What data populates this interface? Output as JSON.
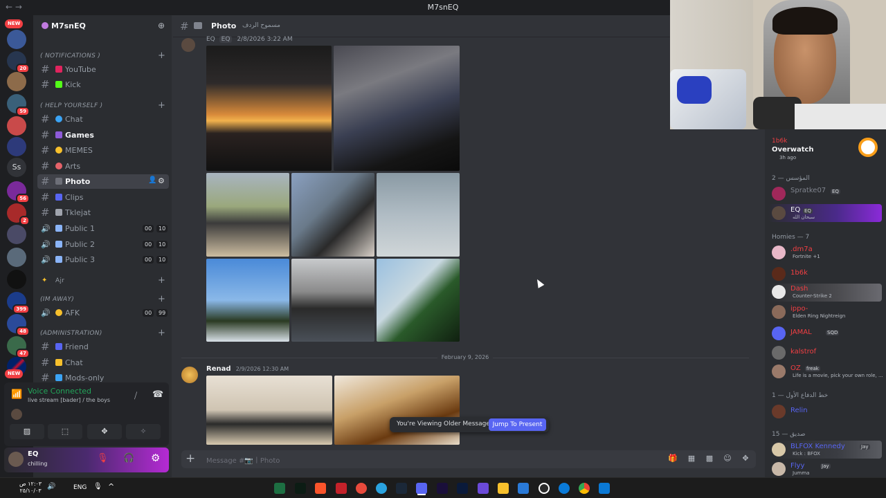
{
  "window": {
    "title": "M7snEQ",
    "nav": "← →"
  },
  "rail": {
    "new_top": "NEW",
    "new_bottom": "NEW",
    "badges": [
      "20",
      "59",
      "56",
      "2",
      "399",
      "48",
      "47"
    ],
    "text_server": "Ss"
  },
  "server": {
    "name": "M7snEQ"
  },
  "categories": {
    "notifications": "( NOTIFICATIONS )",
    "help": "( HELP YOURSELF )",
    "ajr": "Ajr",
    "away": "(IM AWAY)",
    "admin": "(ADMINISTRATION)"
  },
  "channels": {
    "youtube": "YouTube",
    "kick": "Kick",
    "chat": "Chat",
    "games": "Games",
    "memes": "MEMES",
    "arts": "Arts",
    "photo": "Photo",
    "clips": "Clips",
    "tkl": "Tklejat",
    "public1": "Public 1",
    "public2": "Public 2",
    "public3": "Public 3",
    "afk": "AFK",
    "friend": "Friend",
    "chat2": "Chat",
    "mods": "Mods-only",
    "cnt_a": "00",
    "cnt_b": "10",
    "afk_b": "99"
  },
  "voice": {
    "title": "Voice Connected",
    "sub": "live stream [bader] / the boys"
  },
  "user": {
    "name": "EQ",
    "status": "chilling"
  },
  "chat": {
    "channel": "Photo",
    "topic": "مسموح الردف",
    "msg1": {
      "author": "EQ",
      "tag": "EQ",
      "time": "2/8/2026 3:22 AM"
    },
    "date_divider": "February 9, 2026",
    "msg2": {
      "author": "Renad",
      "time": "2/9/2026 12:30 AM"
    },
    "older": "You're Viewing Older Messages",
    "jump": "Jump To Present",
    "placeholder": "Message #📷丨Photo"
  },
  "activity": {
    "user": "1b6k",
    "game": "Overwatch",
    "ago": "3h ago"
  },
  "groups": {
    "founder": "المؤسس — 2",
    "homies": "Homies — 7",
    "first": "خط الدفاع الأول — 1",
    "friends": "صديق — 15"
  },
  "members": [
    {
      "name": "Spratke07",
      "tag": "EQ",
      "color": "#80848e"
    },
    {
      "name": "EQ",
      "tag": "EQ",
      "color": "#f2f3f5",
      "sub": "سبحان الله"
    },
    {
      "name": ".dm7a",
      "act": "Fortnite +1",
      "color": "#f23f43"
    },
    {
      "name": "1b6k",
      "color": "#f23f43"
    },
    {
      "name": "Dash",
      "act": "Counter-Strike 2",
      "color": "#f23f43"
    },
    {
      "name": "ippo-",
      "act": "Elden Ring Nightreign",
      "color": "#f23f43"
    },
    {
      "name": "JAMAL",
      "tag": "SQD",
      "color": "#f23f43"
    },
    {
      "name": "kalstrof",
      "color": "#f23f43"
    },
    {
      "name": "OZ",
      "tag": "freak",
      "act": "Life is a movie, pick your own role, ...",
      "color": "#f23f43"
    },
    {
      "name": "Relin",
      "color": "#5865f2"
    },
    {
      "name": "BLFOX Kennedy",
      "tag": "Jay",
      "act": "Kick : BFOX",
      "color": "#5865f2"
    },
    {
      "name": "Flyy",
      "tag": "Jay",
      "act": "Jumma",
      "color": "#5865f2"
    }
  ],
  "taskbar": {
    "time": "١٢:٠٣ ص",
    "date": "٢٥/١٠/٠٣",
    "lang": "ENG"
  },
  "icons": [
    "hash-icon",
    "camera-icon",
    "speaker-icon",
    "plus-icon",
    "gear-icon",
    "add-member-icon",
    "mic-off-icon",
    "headset-off-icon",
    "screen-share-icon",
    "overwatch-icon",
    "windows-icon"
  ]
}
